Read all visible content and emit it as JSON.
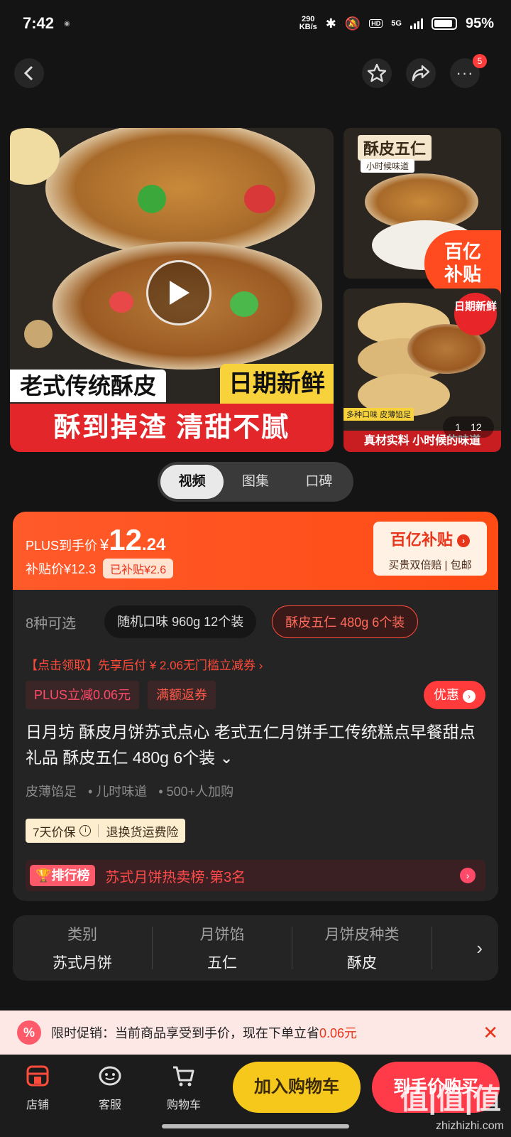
{
  "status": {
    "time": "7:42",
    "speed_top": "290",
    "speed_bottom": "KB/s",
    "hd": "HD",
    "net": "5G",
    "battery": "95%"
  },
  "nav": {
    "badge": "5"
  },
  "gallery": {
    "banner_left": "老式传统酥皮",
    "banner_right": "日期新鲜",
    "banner_bottom": "酥到掉渣 清甜不腻",
    "side1_title": "酥皮五仁",
    "side1_sub": "小时候味道",
    "side2_tag": "日期新鲜",
    "side2_caption": "真材实料 小时候的味道",
    "side2_label": "多种口味 皮薄馅足",
    "counter_current": "1",
    "counter_total": "12",
    "yi_badge_line1": "百亿",
    "yi_badge_line2": "补贴"
  },
  "tabs": [
    "视频",
    "图集",
    "口碑"
  ],
  "price": {
    "plus_label": "PLUS到手价",
    "yen": "¥",
    "int": "12",
    "dec": ".24",
    "subsidy_price": "补贴价¥12.3",
    "subsidized": "已补贴¥2.6",
    "yi_title": "百亿补贴",
    "yi_sub": "买贵双倍赔 | 包邮"
  },
  "variants": {
    "count": "8种可选",
    "options": [
      "随机口味 960g 12个装",
      "酥皮五仁 480g 6个装"
    ]
  },
  "coupon": "【点击领取】先享后付 ¥ 2.06无门槛立减券 ›",
  "promos": [
    "PLUS立减0.06元",
    "满额返券"
  ],
  "youhui": "优惠",
  "product_title": "日月坊 酥皮月饼苏式点心 老式五仁月饼手工传统糕点早餐甜点礼品 酥皮五仁 480g 6个装",
  "tags": [
    "皮薄馅足",
    "• 儿时味道",
    "• 500+人加购"
  ],
  "guarantee": {
    "a": "7天价保",
    "b": "退换货运费险"
  },
  "rank": {
    "badge": "排行榜",
    "text": "苏式月饼热卖榜·第3名"
  },
  "attrs": [
    {
      "k": "类别",
      "v": "苏式月饼"
    },
    {
      "k": "月饼馅",
      "v": "五仁"
    },
    {
      "k": "月饼皮种类",
      "v": "酥皮"
    }
  ],
  "flash": {
    "icon": "%",
    "text": "限时促销：当前商品享受到手价，现在下单立省",
    "amount": "0.06元"
  },
  "bottom": {
    "shop": "店铺",
    "service": "客服",
    "cart": "购物车",
    "add_cart": "加入购物车",
    "buy": "到手价购买"
  },
  "watermark": {
    "big": "值|值|值",
    "small": "zhizhizhi.com"
  }
}
